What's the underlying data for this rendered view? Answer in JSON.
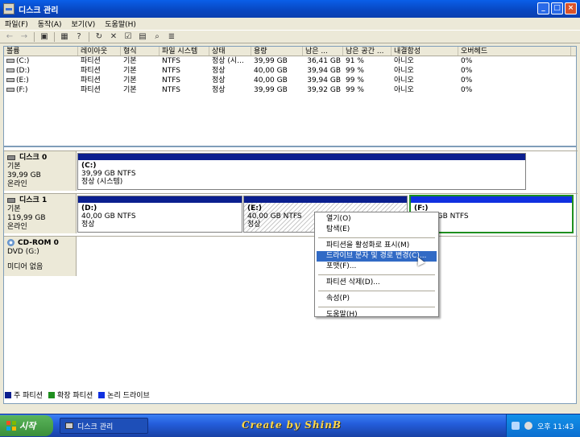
{
  "window": {
    "title": "디스크 관리",
    "buttons": [
      "_",
      "□",
      "×"
    ]
  },
  "menu": [
    "파일(F)",
    "동작(A)",
    "보기(V)",
    "도움말(H)"
  ],
  "toolbar": [
    "back-icon",
    "forward-icon",
    "console-icon",
    "properties-icon",
    "help-icon",
    "connect-icon",
    "delete-icon",
    "check-icon",
    "open-icon",
    "search-icon",
    "list-icon"
  ],
  "volume_list": {
    "headers": [
      "볼륨",
      "레이아웃",
      "형식",
      "파일 시스템",
      "상태",
      "용량",
      "남은 ...",
      "남은 공간 ...",
      "내결함성",
      "오버헤드"
    ],
    "rows": [
      [
        "(C:)",
        "파티션",
        "기본",
        "NTFS",
        "정상 (시...",
        "39,99 GB",
        "36,41 GB",
        "91 %",
        "아니오",
        "0%"
      ],
      [
        "(D:)",
        "파티션",
        "기본",
        "NTFS",
        "정상",
        "40,00 GB",
        "39,94 GB",
        "99 %",
        "아니오",
        "0%"
      ],
      [
        "(E:)",
        "파티션",
        "기본",
        "NTFS",
        "정상",
        "40,00 GB",
        "39,94 GB",
        "99 %",
        "아니오",
        "0%"
      ],
      [
        "(F:)",
        "파티션",
        "기본",
        "NTFS",
        "정상",
        "39,99 GB",
        "39,92 GB",
        "99 %",
        "아니오",
        "0%"
      ]
    ]
  },
  "disks": {
    "d0": {
      "name": "디스크 0",
      "type": "기본",
      "size": "39,99 GB",
      "status": "온라인",
      "c": {
        "vol": "(C:)",
        "size": "39,99 GB NTFS",
        "status": "정상 (시스템)"
      }
    },
    "d1": {
      "name": "디스크 1",
      "type": "기본",
      "size": "119,99 GB",
      "status": "온라인",
      "d": {
        "vol": "(D:)",
        "size": "40,00 GB NTFS",
        "status": "정상"
      },
      "e": {
        "vol": "(E:)",
        "size": "40,00 GB NTFS",
        "status": "정상"
      },
      "f": {
        "vol": "(F:)",
        "size": "39,99 GB NTFS",
        "status": ""
      }
    },
    "cd": {
      "name": "CD-ROM 0",
      "type": "DVD (G:)",
      "status": "미디어 없음"
    }
  },
  "context_menu": {
    "items": [
      "열기(O)",
      "탐색(E)",
      "파티션을 활성화로 표시(M)",
      "드라이브 문자 및 경로 변경(C)...",
      "포맷(F)...",
      "파티션 삭제(D)...",
      "속성(P)",
      "도움말(H)"
    ],
    "highlighted_index": 3
  },
  "legend": [
    {
      "label": "주 파티션",
      "color": "#0B1F8F"
    },
    {
      "label": "확장 파티션",
      "color": "#1f8f1f"
    },
    {
      "label": "논리 드라이브",
      "color": "#1030e0"
    }
  ],
  "taskbar": {
    "start": "시작",
    "task": "디스크 관리",
    "brand": "Create by ShinB",
    "clock": "오후 11:43"
  }
}
